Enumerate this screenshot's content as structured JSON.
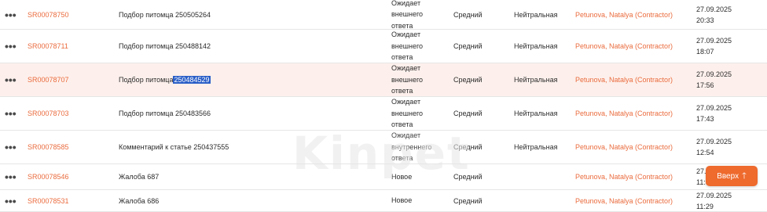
{
  "rows": [
    {
      "id": "SR00078750",
      "subject": "Подбор питомца 250505264",
      "subject_prefix": "",
      "subject_sel": "",
      "status": [
        "Ожидает",
        "внешнего",
        "ответа"
      ],
      "priority": "Средний",
      "mood": "Нейтральная",
      "assignee": "Petunova, Natalya (Contractor)",
      "date": "27.09.2025",
      "time": "20:33"
    },
    {
      "id": "SR00078711",
      "subject": "Подбор питомца 250488142",
      "subject_prefix": "",
      "subject_sel": "",
      "status": [
        "Ожидает",
        "внешнего",
        "ответа"
      ],
      "priority": "Средний",
      "mood": "Нейтральная",
      "assignee": "Petunova, Natalya (Contractor)",
      "date": "27.09.2025",
      "time": "18:07"
    },
    {
      "id": "SR00078707",
      "subject": "",
      "subject_prefix": "Подбор питомца",
      "subject_sel": "250484529",
      "status": [
        "Ожидает",
        "внешнего",
        "ответа"
      ],
      "priority": "Средний",
      "mood": "Нейтральная",
      "assignee": "Petunova, Natalya (Contractor)",
      "date": "27.09.2025",
      "time": "17:56"
    },
    {
      "id": "SR00078703",
      "subject": "Подбор питомца 250483566",
      "subject_prefix": "",
      "subject_sel": "",
      "status": [
        "Ожидает",
        "внешнего",
        "ответа"
      ],
      "priority": "Средний",
      "mood": "Нейтральная",
      "assignee": "Petunova, Natalya (Contractor)",
      "date": "27.09.2025",
      "time": "17:43"
    },
    {
      "id": "SR00078585",
      "subject": "Комментарий к статье 250437555",
      "subject_prefix": "",
      "subject_sel": "",
      "status": [
        "Ожидает",
        "внутреннего",
        "ответа"
      ],
      "priority": "Средний",
      "mood": "Нейтральная",
      "assignee": "Petunova, Natalya (Contractor)",
      "date": "27.09.2025",
      "time": "12:54"
    },
    {
      "id": "SR00078546",
      "subject": "Жалоба 687",
      "subject_prefix": "",
      "subject_sel": "",
      "status": [
        "Новое"
      ],
      "priority": "Средний",
      "mood": "",
      "assignee": "Petunova, Natalya (Contractor)",
      "date": "27.0",
      "time": "11:5"
    },
    {
      "id": "SR00078531",
      "subject": "Жалоба 686",
      "subject_prefix": "",
      "subject_sel": "",
      "status": [
        "Новое"
      ],
      "priority": "Средний",
      "mood": "",
      "assignee": "Petunova, Natalya (Contractor)",
      "date": "27.09.2025",
      "time": "11:29"
    }
  ],
  "row_menu_icon": "more-horizontal-icon",
  "scroll_top_button": {
    "label": "Вверх",
    "icon": "arrow-up-icon",
    "arrow": "🡑"
  },
  "watermark": "Kinpet",
  "colors": {
    "accent": "#ea6b3d",
    "highlight_row": "#fdf0ec",
    "selection": "#2a5ec7",
    "button": "#ee6a2d"
  }
}
